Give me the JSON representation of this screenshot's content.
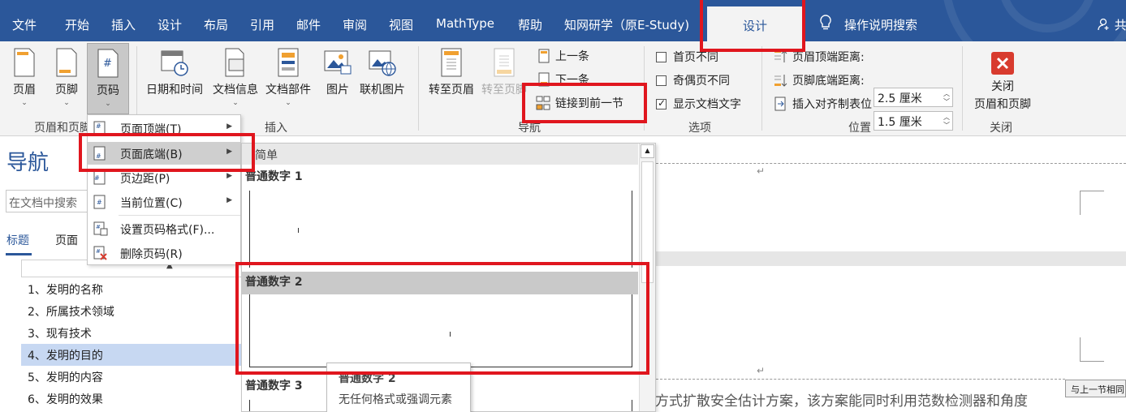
{
  "tabs": [
    "文件",
    "开始",
    "插入",
    "设计",
    "布局",
    "引用",
    "邮件",
    "审阅",
    "视图",
    "MathType",
    "帮助",
    "知网研学（原E-Study)"
  ],
  "active_tab": "设计",
  "search_tab": "操作说明搜索",
  "share_label": "共",
  "ribbon": {
    "header_footer": {
      "header": "页眉",
      "footer": "页脚",
      "page_number": "页码",
      "group_label": "页眉和页脚"
    },
    "insert": {
      "date_time": "日期和时间",
      "doc_info": "文档信息",
      "doc_parts": "文档部件",
      "picture": "图片",
      "online_picture": "联机图片",
      "group_label": "插入"
    },
    "navigation": {
      "goto_header": "转至页眉",
      "goto_footer": "转至页脚",
      "previous": "上一条",
      "next": "下一条",
      "link_to_previous": "链接到前一节",
      "group_label": "导航"
    },
    "options": {
      "diff_first": "首页不同",
      "diff_odd_even": "奇偶页不同",
      "show_doc_text": "显示文档文字",
      "group_label": "选项"
    },
    "position": {
      "header_distance_label": "页眉顶端距离:",
      "header_distance_value": "2.5 厘米",
      "footer_distance_label": "页脚底端距离:",
      "footer_distance_value": "1.5 厘米",
      "insert_align_tab": "插入对齐制表位",
      "group_label": "位置"
    },
    "close": {
      "label_line1": "关闭",
      "label_line2": "页眉和页脚",
      "group_label": "关闭"
    }
  },
  "nav_pane": {
    "title": "导航",
    "search_placeholder": "在文档中搜索",
    "tab_headings": "标题",
    "tab_pages": "页面",
    "items": [
      "1、发明的名称",
      "2、所属技术领域",
      "3、现有技术",
      "4、发明的目的",
      "5、发明的内容",
      "6、发明的效果"
    ],
    "selected_index": 3
  },
  "context_menu": {
    "items": [
      {
        "label": "页面顶端(T)",
        "submenu": true
      },
      {
        "label": "页面底端(B)",
        "submenu": true
      },
      {
        "label": "页边距(P)",
        "submenu": true
      },
      {
        "label": "当前位置(C)",
        "submenu": true
      },
      {
        "label": "设置页码格式(F)...",
        "submenu": false
      },
      {
        "label": "删除页码(R)",
        "submenu": false
      }
    ],
    "highlighted_index": 1
  },
  "gallery": {
    "section": "简单",
    "items": [
      "普通数字 1",
      "普通数字 2",
      "普通数字 3"
    ],
    "selected_index": 1
  },
  "tooltip": {
    "title": "普通数字 2",
    "description": "无任何格式或强调元素"
  },
  "document": {
    "same_as_previous": "与上一节相同",
    "body_text": "方式扩散安全估计方案，该方案能同时利用范数检测器和角度",
    "paragraph_mark": "↵"
  }
}
